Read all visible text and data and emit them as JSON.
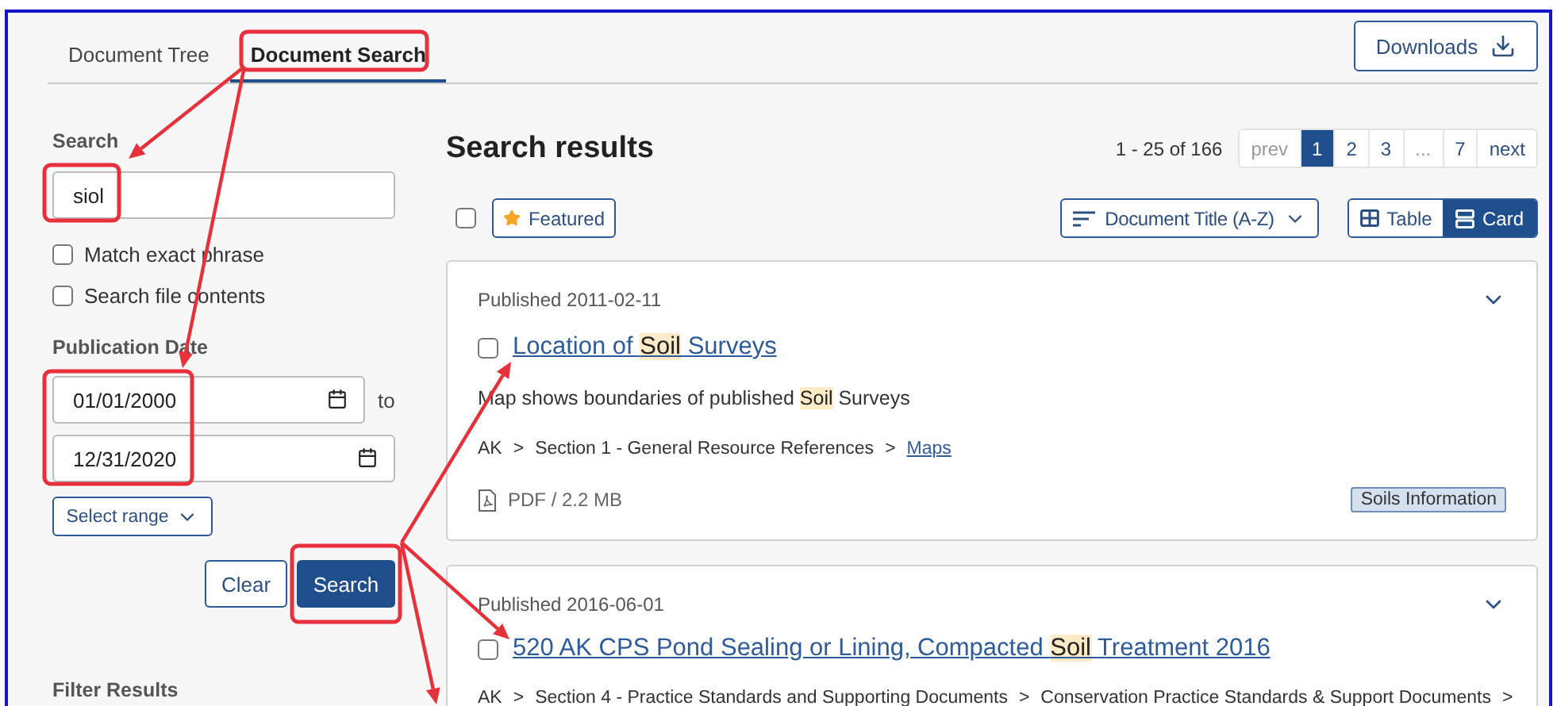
{
  "tabs": [
    {
      "label": "Document Tree",
      "selected": false
    },
    {
      "label": "Document Search",
      "selected": true
    }
  ],
  "downloads_button": "Downloads",
  "search_panel": {
    "search_label": "Search",
    "search_value": "siol",
    "options": [
      {
        "label": "Match exact phrase",
        "checked": false
      },
      {
        "label": "Search file contents",
        "checked": false
      }
    ],
    "date_label": "Publication Date",
    "date_from": "01/01/2000",
    "date_to_label": "to",
    "date_to": "12/31/2020",
    "range_button": "Select range",
    "clear_button": "Clear",
    "search_button": "Search",
    "filter_heading": "Filter Results"
  },
  "results": {
    "heading": "Search results",
    "count": "1 - 25 of 166",
    "pagination": [
      {
        "label": "prev",
        "selected": false,
        "disabled": true
      },
      {
        "label": "1",
        "selected": true,
        "disabled": false
      },
      {
        "label": "2",
        "selected": false,
        "disabled": false
      },
      {
        "label": "3",
        "selected": false,
        "disabled": false
      },
      {
        "label": "...",
        "selected": false,
        "disabled": true
      },
      {
        "label": "7",
        "selected": false,
        "disabled": false
      },
      {
        "label": "next",
        "selected": false,
        "disabled": false
      }
    ],
    "select_all_checked": false,
    "featured_button": "Featured",
    "sort_button": "Document Title (A-Z)",
    "views": [
      {
        "label": "Table",
        "selected": false
      },
      {
        "label": "Card",
        "selected": true
      }
    ],
    "items": [
      {
        "published": "Published 2011-02-11",
        "checked": false,
        "title_parts": [
          {
            "text": "Location of ",
            "highlighted": false
          },
          {
            "text": "Soil",
            "highlighted": true
          },
          {
            "text": " Surveys",
            "highlighted": false
          }
        ],
        "description_parts": [
          {
            "text": "Map shows boundaries of published ",
            "highlighted": false
          },
          {
            "text": "Soil",
            "highlighted": true
          },
          {
            "text": " Surveys",
            "highlighted": false
          }
        ],
        "breadcrumb": [
          {
            "kind": "text",
            "text": "AK"
          },
          {
            "kind": "separator",
            "text": ">"
          },
          {
            "kind": "text",
            "text": "Section 1 - General Resource References"
          },
          {
            "kind": "separator",
            "text": ">"
          },
          {
            "kind": "link",
            "text": "Maps"
          }
        ],
        "file_info": "PDF / 2.2 MB",
        "tag": "Soils Information"
      },
      {
        "published": "Published 2016-06-01",
        "checked": false,
        "title_parts": [
          {
            "text": "520 AK CPS Pond Sealing or Lining, Compacted ",
            "highlighted": false
          },
          {
            "text": "Soil",
            "highlighted": true
          },
          {
            "text": " Treatment 2016",
            "highlighted": false
          }
        ],
        "breadcrumb": [
          {
            "kind": "text",
            "text": "AK"
          },
          {
            "kind": "separator",
            "text": ">"
          },
          {
            "kind": "text",
            "text": "Section 4 - Practice Standards and Supporting Documents"
          },
          {
            "kind": "separator",
            "text": ">"
          },
          {
            "kind": "text",
            "text": "Conservation Practice Standards & Support Documents"
          },
          {
            "kind": "separator",
            "text": ">"
          }
        ]
      }
    ]
  }
}
